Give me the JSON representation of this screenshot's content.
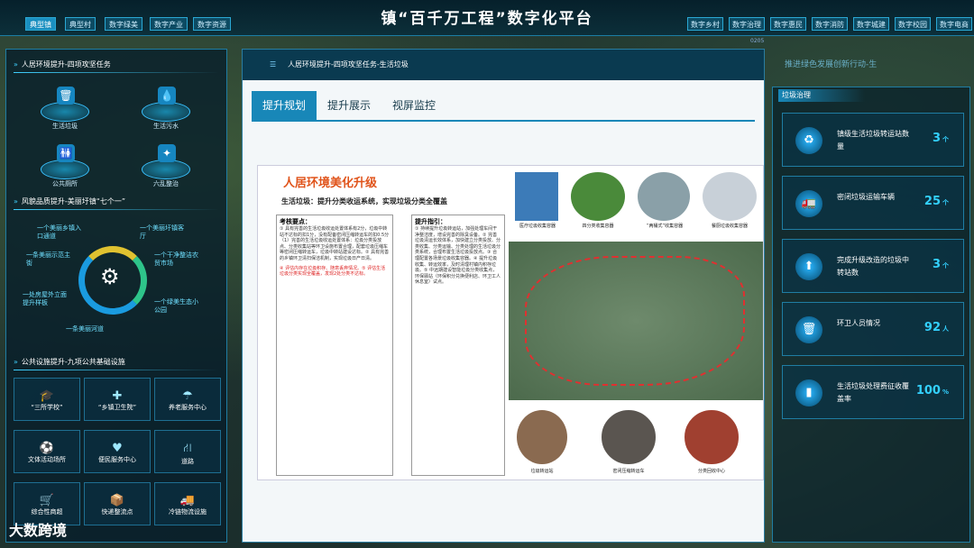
{
  "app": {
    "title": "镇“百千万工程”数字化平台",
    "code": "0205",
    "ghost": "推进绿色发展创新行动-生"
  },
  "top_tabs_left": [
    "典型镇",
    "典型村",
    "数字绿美",
    "数字产业",
    "数字资源"
  ],
  "top_tabs_right": [
    "数字乡村",
    "数字治理",
    "数字惠民",
    "数字消防",
    "数字城建",
    "数字校园",
    "数字电商"
  ],
  "left": {
    "sec1": "人居环境提升-四项攻坚任务",
    "tiles": [
      {
        "label": "生活垃圾",
        "icon": "🗑"
      },
      {
        "label": "生活污水",
        "icon": "💧"
      },
      {
        "label": "公共厕所",
        "icon": "🚻"
      },
      {
        "label": "六乱整治",
        "icon": "✦"
      }
    ],
    "sec2": "风貌品质提升-美丽圩镇“七个一”",
    "ring_labels": [
      "一个美丽乡镇入口通道",
      "一个美丽圩镇客厅",
      "一条美丽示范主街",
      "一个干净整洁农贸市场",
      "一处房屋外立面提升样板",
      "一个绿美生态小公园",
      "一条美丽河道"
    ],
    "sec3": "公共设施提升-九项公共基础设施",
    "facilities": [
      {
        "label": "“三所学校”",
        "icon": "🎓"
      },
      {
        "label": "“乡镇卫生院”",
        "icon": "✚"
      },
      {
        "label": "养老服务中心",
        "icon": "☂"
      },
      {
        "label": "文体活动场所",
        "icon": "⚽"
      },
      {
        "label": "便民服务中心",
        "icon": "♥"
      },
      {
        "label": "道路",
        "icon": "⛙"
      },
      {
        "label": "综合性商超",
        "icon": "🛒"
      },
      {
        "label": "快递整流点",
        "icon": "📦"
      },
      {
        "label": "冷链物流设施",
        "icon": "🚚"
      }
    ]
  },
  "modal": {
    "header": "人居环境提升-四项攻坚任务-生活垃圾",
    "tabs": [
      "提升规划",
      "提升展示",
      "视屏监控"
    ],
    "doc_title": "人居环境美化升级",
    "doc_sub": "生活垃圾：提升分类收运系统，实现垃圾分类全覆盖",
    "box1_title": "考核要点：",
    "box1_text": "① 具有完善的生活垃圾收运处置体系有2分，垃圾中转站不达标的扣1分，没有配备密闭压缩转运车的扣0.5分（1）完善的生活垃圾收运处置体系：垃圾分类投放点、分类收集站等环卫设施布置合理，配套垃圾压缩车等密闭压缩转运车，垃圾中转站建设达标。② 具有完善的乡镇环卫清扫保洁机制，实现垃圾日产日清。",
    "box1_red": "④ 评估内存在垃圾积存、随意丢弃情况。⑤ 评估生活垃圾分类实现全覆盖，发现2处分类不达标。",
    "box2_title": "提升指引：",
    "box2_text": "① 持续提升垃圾转运站，加强处理车间干净整洁度，增设完善的除臭设备。② 完善垃圾清运长效体系，加快建立分类投放、分类收集、分类运输、分类处理的生活垃圾分类系统，合理布置生活垃圾投放点。③ 合理配置各场景垃圾收集容器。④ 提升垃圾收集、转运效率，及时清理村镇内积存垃圾。⑤ 中远期建设智能垃圾分类收集点，环保驿站（环保积分兑换便利店、环卫工人休息室）试点。",
    "top_photos": [
      "医疗垃圾收集容器",
      "四分类收集容器",
      "“两桶式”收集容器",
      "餐厨垃圾收集容器"
    ],
    "bottom_photos": [
      "垃圾转运站",
      "密闭压缩转运车",
      "分类回收中心"
    ]
  },
  "right": {
    "title": "垃圾治理",
    "cards": [
      {
        "label": "镇级生活垃圾转运站数量",
        "value": "3",
        "unit": "个",
        "icon": "♻"
      },
      {
        "label": "密闭垃圾运输车辆",
        "value": "25",
        "unit": "个",
        "icon": "🚛"
      },
      {
        "label": "完成升级改造的垃圾中转站数",
        "value": "3",
        "unit": "个",
        "icon": "⬆"
      },
      {
        "label": "环卫人员情况",
        "value": "92",
        "unit": "人",
        "icon": "🗑"
      },
      {
        "label": "生活垃圾处理费征收覆盖率",
        "value": "100",
        "unit": "%",
        "icon": "▮"
      }
    ]
  },
  "watermark": "大数跨境"
}
